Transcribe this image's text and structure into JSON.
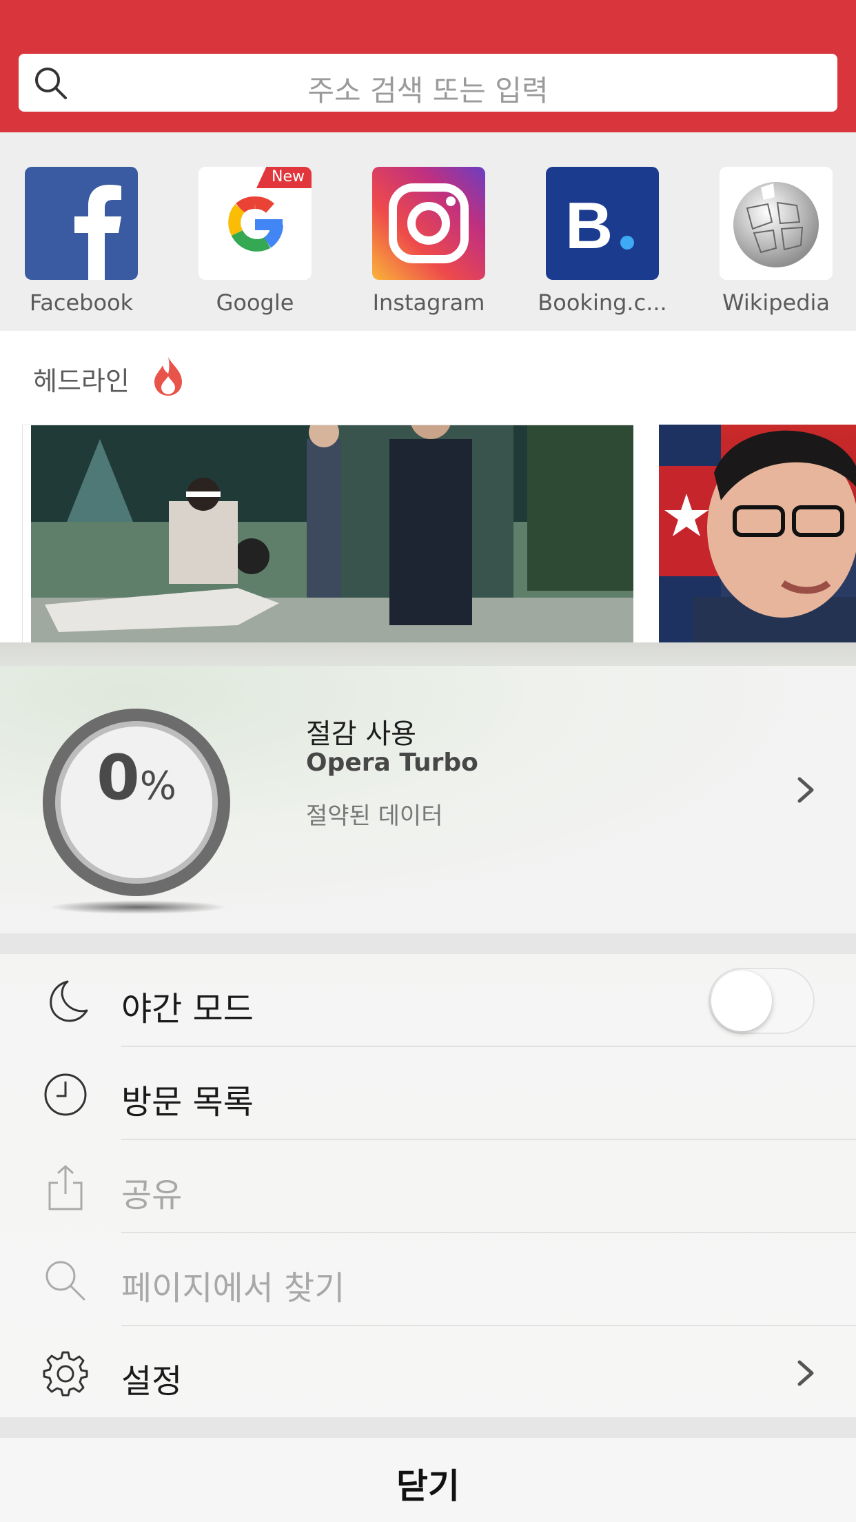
{
  "search": {
    "placeholder": "주소 검색 또는 입력"
  },
  "speed_dial": [
    {
      "label": "Facebook",
      "icon": "facebook-icon"
    },
    {
      "label": "Google",
      "icon": "google-icon",
      "badge": "New"
    },
    {
      "label": "Instagram",
      "icon": "instagram-icon"
    },
    {
      "label": "Booking.c...",
      "icon": "booking-icon"
    },
    {
      "label": "Wikipedia",
      "icon": "wikipedia-icon"
    }
  ],
  "headlines": {
    "title": "헤드라인",
    "icon": "flame-icon"
  },
  "turbo": {
    "percent": "0",
    "percent_sign": "%",
    "title": "절감 사용",
    "name": "Opera Turbo",
    "subtitle": "절약된 데이터"
  },
  "menu": [
    {
      "label": "야간 모드",
      "icon": "moon-icon",
      "toggle": false
    },
    {
      "label": "방문 목록",
      "icon": "clock-icon"
    },
    {
      "label": "공유",
      "icon": "share-icon",
      "disabled": true
    },
    {
      "label": "페이지에서 찾기",
      "icon": "search-icon",
      "disabled": true
    },
    {
      "label": "설정",
      "icon": "gear-icon"
    }
  ],
  "close_label": "닫기",
  "colors": {
    "header": "#d8363c",
    "accent": "#e0363c"
  }
}
